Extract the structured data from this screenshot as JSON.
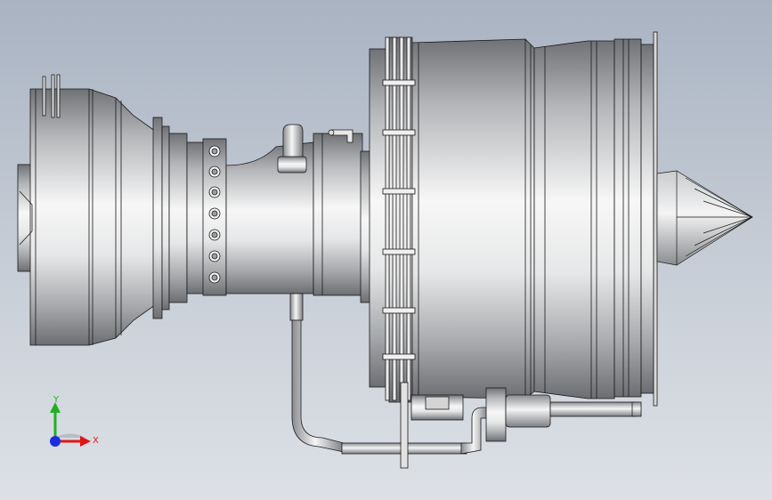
{
  "viewport": {
    "view_name": "",
    "model": "turbofan-engine-assembly"
  },
  "colors": {
    "background_top": "#a9b3c2",
    "background_bottom": "#dde1e6",
    "metal_dark": "#6e7074",
    "metal_light": "#f6f6f6",
    "edge": "#1a1a1a",
    "axis_x": "#e01515",
    "axis_y": "#20b020",
    "axis_z": "#1a2de0"
  },
  "triad": {
    "x_label": "X",
    "y_label": "Y",
    "icon": "coordinate-triad-icon"
  }
}
